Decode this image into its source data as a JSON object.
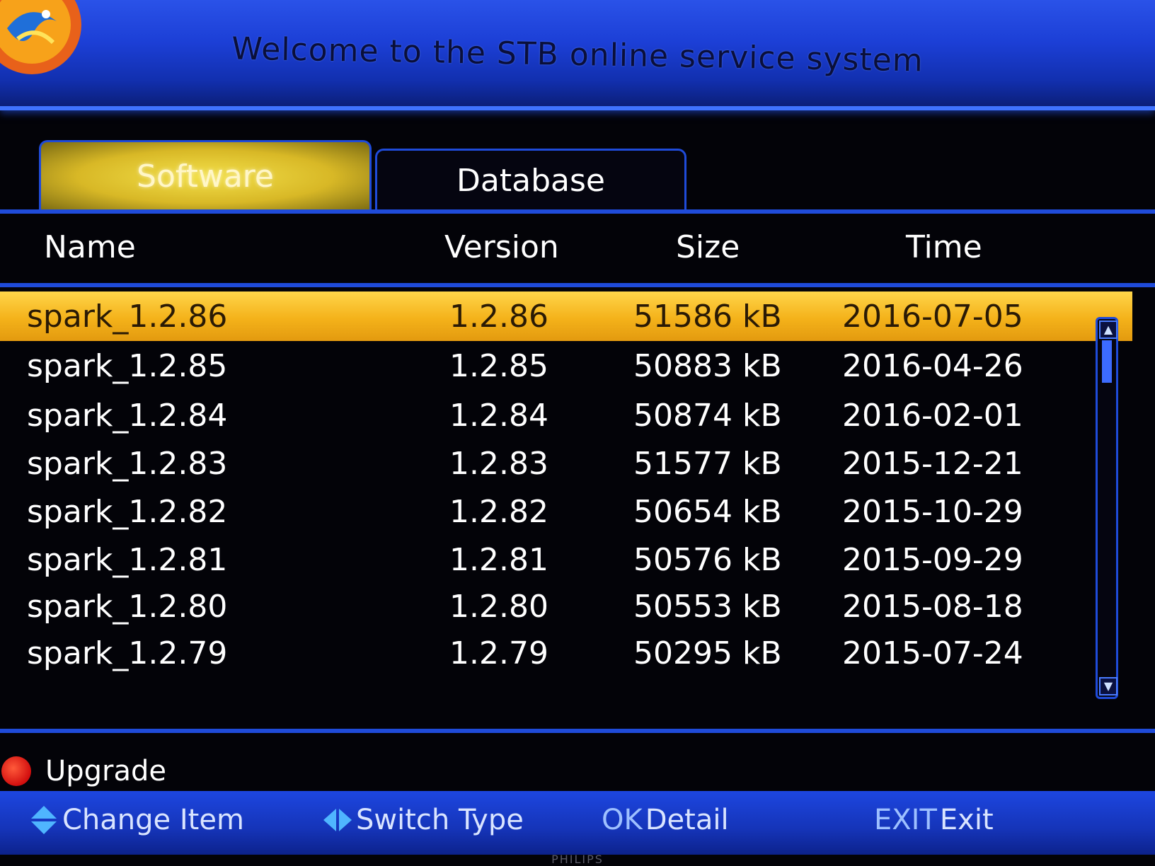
{
  "header": {
    "title": "Welcome to the STB online service system"
  },
  "tabs": [
    {
      "label": "Software",
      "active": true
    },
    {
      "label": "Database",
      "active": false
    }
  ],
  "table": {
    "columns": [
      "Name",
      "Version",
      "Size",
      "Time"
    ],
    "rows": [
      {
        "name": "spark_1.2.86",
        "version": "1.2.86",
        "size": "51586 kB",
        "time": "2016-07-05",
        "selected": true
      },
      {
        "name": "spark_1.2.85",
        "version": "1.2.85",
        "size": "50883 kB",
        "time": "2016-04-26"
      },
      {
        "name": "spark_1.2.84",
        "version": "1.2.84",
        "size": "50874 kB",
        "time": "2016-02-01"
      },
      {
        "name": "spark_1.2.83",
        "version": "1.2.83",
        "size": "51577 kB",
        "time": "2015-12-21"
      },
      {
        "name": "spark_1.2.82",
        "version": "1.2.82",
        "size": "50654 kB",
        "time": "2015-10-29"
      },
      {
        "name": "spark_1.2.81",
        "version": "1.2.81",
        "size": "50576 kB",
        "time": "2015-09-29"
      },
      {
        "name": "spark_1.2.80",
        "version": "1.2.80",
        "size": "50553 kB",
        "time": "2015-08-18"
      },
      {
        "name": "spark_1.2.79",
        "version": "1.2.79",
        "size": "50295 kB",
        "time": "2015-07-24"
      }
    ]
  },
  "footer": {
    "upgrade_label": "Upgrade",
    "help": {
      "change_item": "Change Item",
      "switch_type": "Switch Type",
      "ok_key": "OK",
      "ok_label": "Detail",
      "exit_key": "EXIT",
      "exit_label": "Exit"
    }
  },
  "brand": "PHILIPS",
  "colors": {
    "selection": "#f4b21a",
    "accent_blue": "#1f4bd9",
    "red_button": "#d20e0e"
  },
  "icons": {
    "logo": "dragon-logo-icon",
    "up_down": "up-down-arrows-icon",
    "left_right": "left-right-arrows-icon",
    "red_key": "red-button-icon"
  }
}
